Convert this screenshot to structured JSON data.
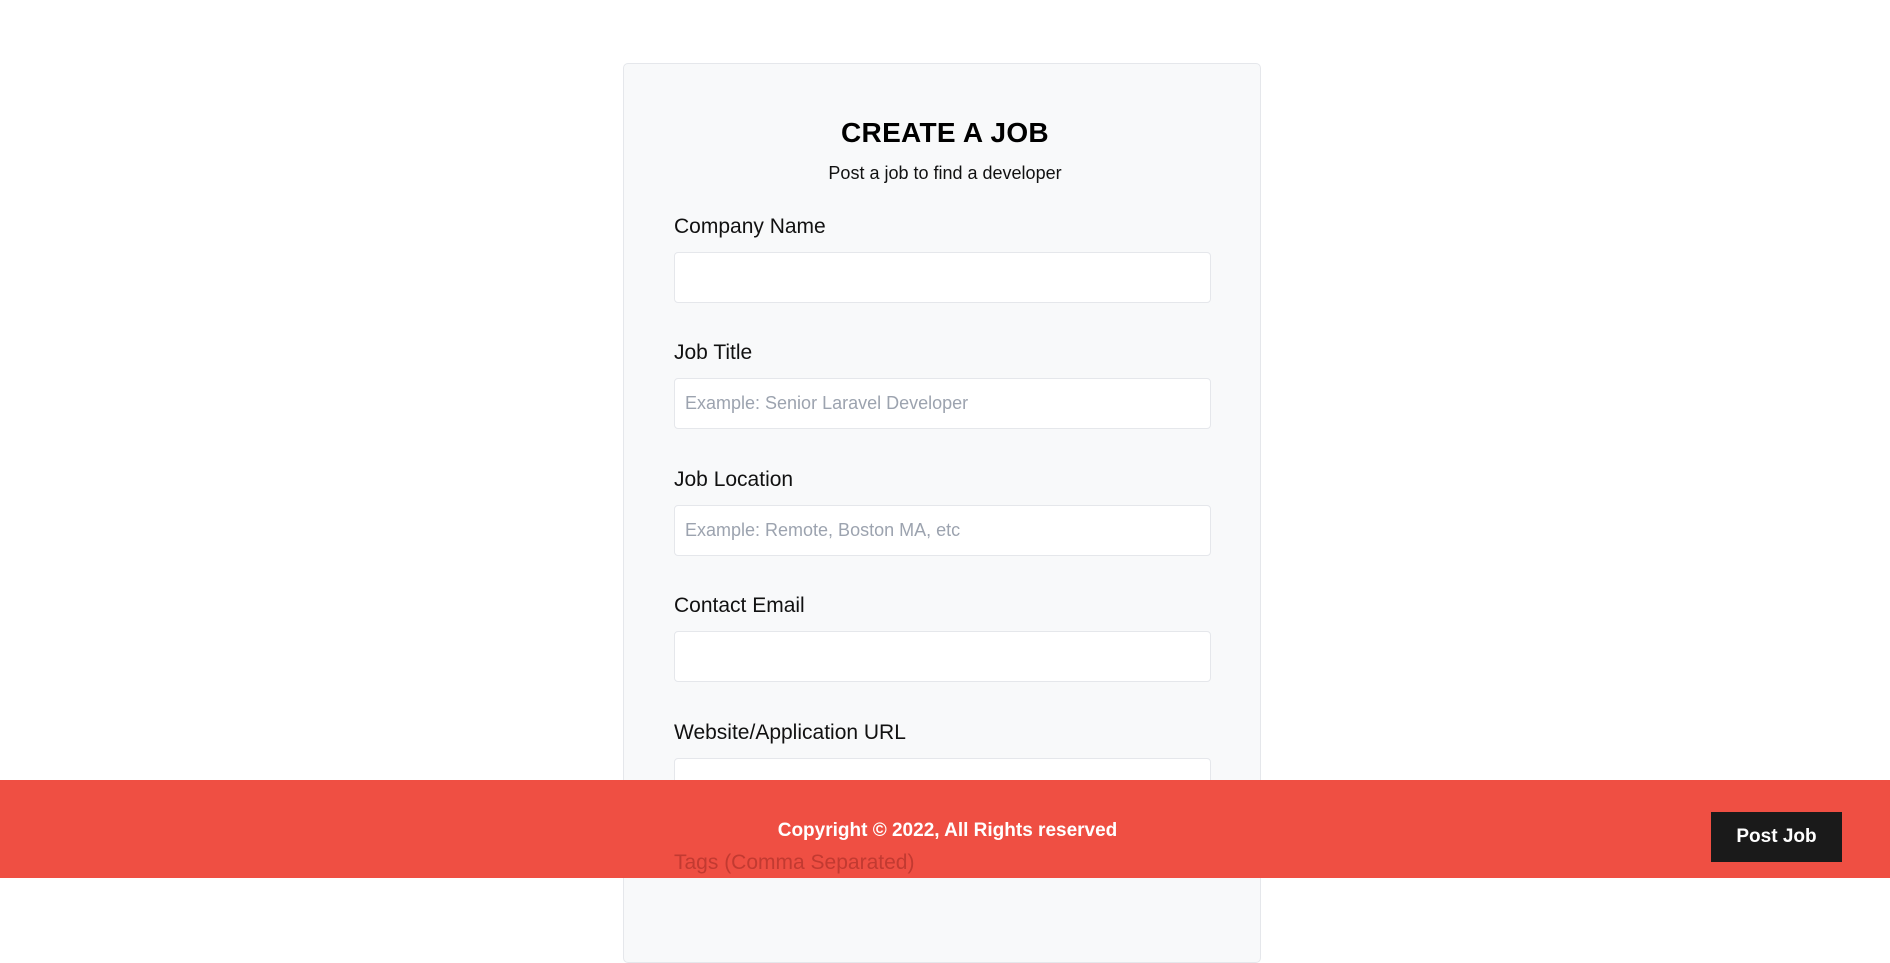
{
  "form": {
    "title": "CREATE A JOB",
    "subtitle": "Post a job to find a developer",
    "fields": [
      {
        "label": "Company Name",
        "value": "",
        "placeholder": ""
      },
      {
        "label": "Job Title",
        "value": "",
        "placeholder": "Example: Senior Laravel Developer"
      },
      {
        "label": "Job Location",
        "value": "",
        "placeholder": "Example: Remote, Boston MA, etc"
      },
      {
        "label": "Contact Email",
        "value": "",
        "placeholder": ""
      },
      {
        "label": "Website/Application URL",
        "value": "",
        "placeholder": ""
      },
      {
        "label": "Tags (Comma Separated)"
      }
    ]
  },
  "footer": {
    "copyright": "Copyright © 2022, All Rights reserved",
    "post_job_label": "Post Job",
    "background_color": "#ef4f43"
  }
}
